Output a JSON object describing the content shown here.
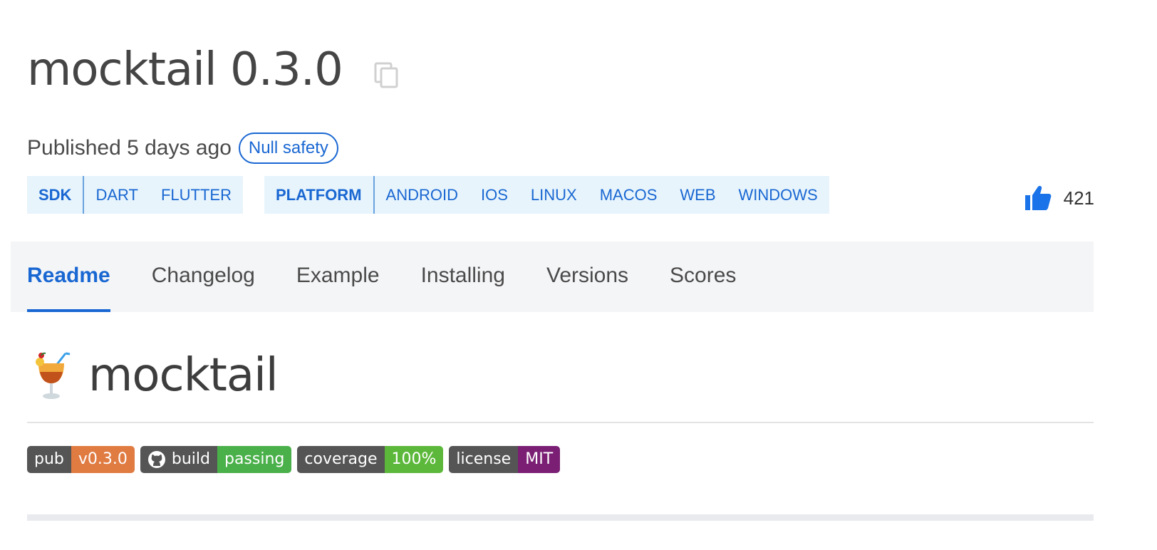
{
  "package": {
    "title": "mocktail 0.3.0",
    "published": "Published 5 days ago",
    "null_safety_badge": "Null safety"
  },
  "tags": {
    "sdk": {
      "label": "SDK",
      "items": [
        "DART",
        "FLUTTER"
      ]
    },
    "platform": {
      "label": "PLATFORM",
      "items": [
        "ANDROID",
        "IOS",
        "LINUX",
        "MACOS",
        "WEB",
        "WINDOWS"
      ]
    }
  },
  "likes": {
    "count": "421",
    "icon": "thumbs-up-icon"
  },
  "tabs": [
    {
      "label": "Readme",
      "active": true
    },
    {
      "label": "Changelog",
      "active": false
    },
    {
      "label": "Example",
      "active": false
    },
    {
      "label": "Installing",
      "active": false
    },
    {
      "label": "Versions",
      "active": false
    },
    {
      "label": "Scores",
      "active": false
    }
  ],
  "readme": {
    "title": "mocktail",
    "icon": "cocktail-icon"
  },
  "badges": [
    {
      "label": "pub",
      "value": "v0.3.0",
      "color": "#e05d44",
      "icon": ""
    },
    {
      "label": "build",
      "value": "passing",
      "color": "#4ab04a",
      "icon": "github-icon"
    },
    {
      "label": "coverage",
      "value": "100%",
      "color": "#4ab04a",
      "icon": ""
    },
    {
      "label": "license",
      "value": "MIT",
      "color": "#7a1f74",
      "icon": ""
    }
  ],
  "colors": {
    "accent": "#1967d2",
    "tag_bg": "#e7f4fc",
    "tabs_bg": "#f4f5f7",
    "pub_badge": "#e07b42",
    "build_badge": "#4ab04a",
    "coverage_badge": "#5cb83a",
    "license_badge": "#7a1f74"
  }
}
